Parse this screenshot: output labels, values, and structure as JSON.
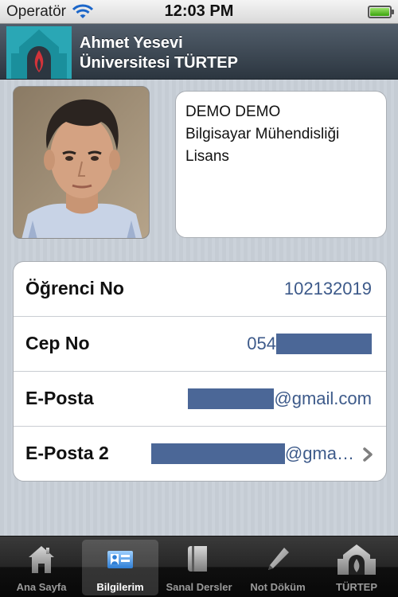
{
  "status_bar": {
    "carrier": "Operatör",
    "time": "12:03 PM",
    "battery_level": 1.0
  },
  "header": {
    "title_line1": "Ahmet Yesevi",
    "title_line2": "Üniversitesi TÜRTEP"
  },
  "profile": {
    "name": "DEMO DEMO",
    "department": "Bilgisayar Mühendisliği",
    "degree": "Lisans"
  },
  "details": [
    {
      "label": "Öğrenci No",
      "value": "102132019"
    },
    {
      "label": "Cep No",
      "value": "054"
    },
    {
      "label": "E-Posta",
      "value": "@gmail.com"
    },
    {
      "label": "E-Posta 2",
      "value": "@gma…"
    }
  ],
  "tab_bar": {
    "items": [
      {
        "label": "Ana Sayfa",
        "icon": "home-icon"
      },
      {
        "label": "Bilgilerim",
        "icon": "id-card-icon"
      },
      {
        "label": "Sanal Dersler",
        "icon": "book-icon"
      },
      {
        "label": "Not Döküm",
        "icon": "pencil-icon"
      },
      {
        "label": "TÜRTEP",
        "icon": "turtep-logo-icon"
      }
    ],
    "selected": "Bilgilerim"
  },
  "colors": {
    "header_bg": "#3a4652",
    "logo_teal": "#2aa7b5",
    "value_blue": "#3d5a8a",
    "redaction": "#4b6797"
  }
}
